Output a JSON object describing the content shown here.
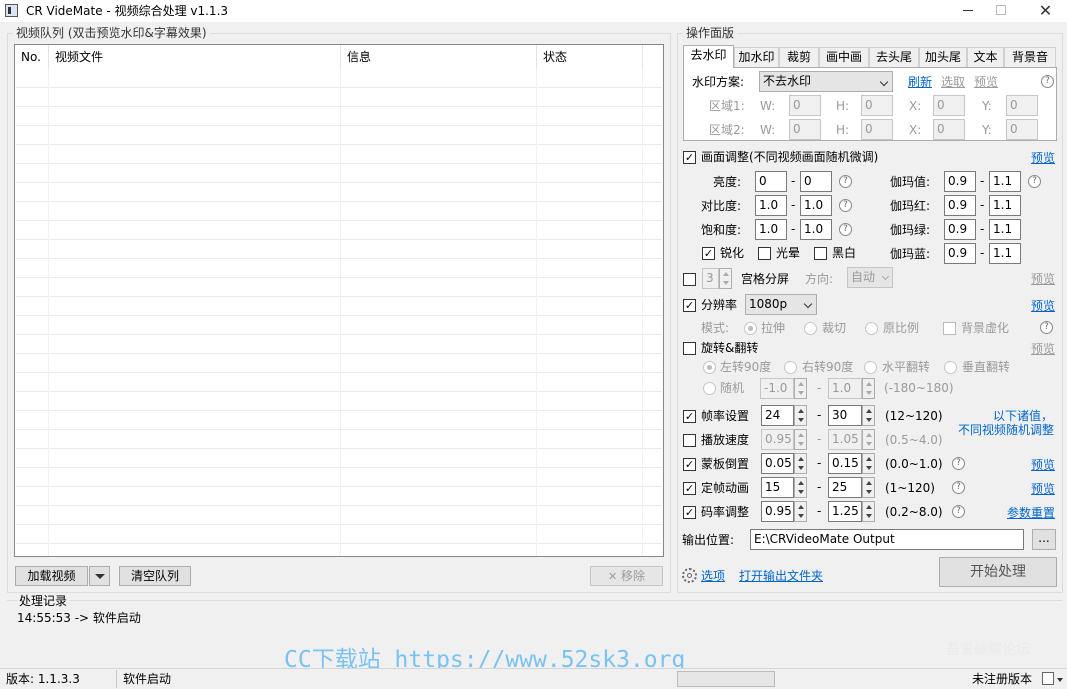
{
  "window": {
    "title": "CR VideMate - 视频综合处理 v1.1.3"
  },
  "queue": {
    "title": "视频队列 (双击预览水印&字幕效果)",
    "columns": [
      "No.",
      "视频文件",
      "信息",
      "状态"
    ],
    "load_button": "加载视频",
    "clear_button": "清空队列",
    "remove_button": "移除"
  },
  "panel": {
    "title": "操作面版",
    "tabs": [
      "去水印",
      "加水印",
      "裁剪",
      "画中画",
      "去头尾",
      "加头尾",
      "文本",
      "背景音"
    ],
    "watermark": {
      "scheme_label": "水印方案:",
      "scheme_value": "不去水印",
      "refresh": "刷新",
      "select": "选取",
      "preview": "预览",
      "region1": "区域1:",
      "region2": "区域2:",
      "w": "W:",
      "h": "H:",
      "x": "X:",
      "y": "Y:",
      "r1": [
        "0",
        "0",
        "0",
        "0"
      ],
      "r2": [
        "0",
        "0",
        "0",
        "0"
      ]
    },
    "picture": {
      "label": "画面调整(不同视频画面随机微调)",
      "preview": "预览",
      "brightness_label": "亮度:",
      "brightness": [
        "0",
        "0"
      ],
      "contrast_label": "对比度:",
      "contrast": [
        "1.0",
        "1.0"
      ],
      "saturation_label": "饱和度:",
      "saturation": [
        "1.0",
        "1.0"
      ],
      "gamma_label": "伽玛值:",
      "gamma": [
        "0.9",
        "1.1"
      ],
      "gamma_red_label": "伽玛红:",
      "gamma_red": [
        "0.9",
        "1.1"
      ],
      "gamma_green_label": "伽玛绿:",
      "gamma_green": [
        "0.9",
        "1.1"
      ],
      "gamma_blue_label": "伽玛蓝:",
      "gamma_blue": [
        "0.9",
        "1.1"
      ],
      "sharpen": "锐化",
      "glow": "光晕",
      "bw": "黑白"
    },
    "grid": {
      "count": "3",
      "label": "宫格分屏",
      "dir_label": "方向:",
      "dir_value": "自动",
      "preview": "预览"
    },
    "resolution": {
      "label": "分辨率",
      "value": "1080p",
      "preview": "预览",
      "mode_label": "模式:",
      "modes": [
        "拉伸",
        "裁切",
        "原比例"
      ],
      "blur_bg": "背景虚化"
    },
    "rotate": {
      "label": "旋转&翻转",
      "preview": "预览",
      "options": [
        "左转90度",
        "右转90度",
        "水平翻转",
        "垂直翻转"
      ],
      "random": "随机",
      "range": [
        "-1.0",
        "1.0"
      ],
      "range_hint": "(-180~180)"
    },
    "params": [
      {
        "label": "帧率设置",
        "from": "24",
        "to": "30",
        "range": "(12~120)",
        "checked": true
      },
      {
        "label": "播放速度",
        "from": "0.95",
        "to": "1.05",
        "range": "(0.5~4.0)",
        "checked": false
      },
      {
        "label": "蒙板倒置",
        "from": "0.05",
        "to": "0.15",
        "range": "(0.0~1.0)",
        "checked": true
      },
      {
        "label": "定帧动画",
        "from": "15",
        "to": "25",
        "range": "(1~120)",
        "checked": true
      },
      {
        "label": "码率调整",
        "from": "0.95",
        "to": "1.25",
        "range": "(0.2~8.0)",
        "checked": true
      }
    ],
    "random_hint_1": "以下诸值，",
    "random_hint_2": "不同视频随机调整",
    "mask_preview": "预览",
    "freeze_preview": "预览",
    "reset": "参数重置",
    "output_label": "输出位置:",
    "output_path": "E:\\CRVideoMate Output",
    "browse": "...",
    "options": "选项",
    "open_folder": "打开输出文件夹",
    "start": "开始处理"
  },
  "log": {
    "title": "处理记录",
    "entry": "14:55:53 -> 软件启动"
  },
  "status": {
    "version": "版本: 1.1.3.3",
    "state": "软件启动",
    "reg": "未注册版本"
  },
  "watermarks": {
    "left": "CC下载站 https://www.52sk3.org",
    "right": "吾爱破解论坛"
  },
  "dash": "-",
  "help": "?"
}
